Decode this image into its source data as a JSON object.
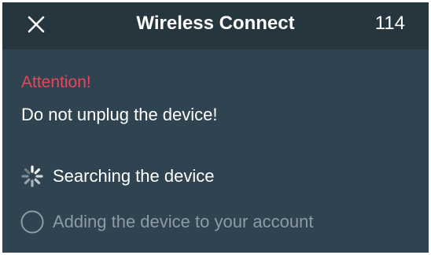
{
  "header": {
    "title": "Wireless Connect",
    "count": "114",
    "close_icon": "close-icon"
  },
  "notice": {
    "attention": "Attention!",
    "warning": "Do not unplug the device!"
  },
  "steps": [
    {
      "label": "Searching the device",
      "icon": "spinner-icon",
      "status": "in-progress"
    },
    {
      "label": "Adding the device to your account",
      "icon": "empty-circle-icon",
      "status": "pending"
    }
  ],
  "colors": {
    "background": "#2f4350",
    "header": "#26363f",
    "attention": "#e8475d",
    "text": "#ffffff",
    "muted": "#8e9ba3"
  }
}
